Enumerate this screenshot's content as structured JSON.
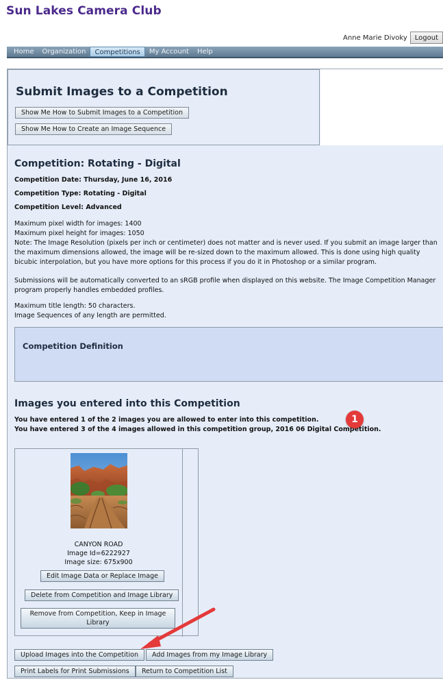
{
  "site": {
    "title": "Sun Lakes Camera Club"
  },
  "user": {
    "name": "Anne Marie Divoky",
    "logout_label": "Logout"
  },
  "nav": {
    "items": [
      "Home",
      "Organization",
      "Competitions",
      "My Account",
      "Help"
    ],
    "active": "Competitions"
  },
  "submit": {
    "title": "Submit Images to a Competition",
    "btn_how_submit": "Show Me How to Submit Images to a Competition",
    "btn_how_sequence": "Show Me How to Create an Image Sequence"
  },
  "competition": {
    "title": "Competition: Rotating - Digital",
    "date": "Competition Date: Thursday, June 16, 2016",
    "type": "Competition Type: Rotating - Digital",
    "level": "Competition Level: Advanced",
    "max_width": "Maximum pixel width for images: 1400",
    "max_height": "Maximum pixel height for images: 1050",
    "note": "Note: The Image Resolution (pixels per inch or centimeter) does not matter and is never used. If you submit an image larger than the maximum dimensions allowed, the image will be re-sized down to the maximum allowed. This is done using high quality bicubic interpolation, but you have more options for this process if you do it in Photoshop or a similar program.",
    "srgb": "Submissions will be automatically converted to an sRGB profile when displayed on this website. The Image Competition Manager program properly handles embedded profiles.",
    "max_title": "Maximum title length: 50 characters.",
    "sequences": "Image Sequences of any length are permitted.",
    "definition_title": "Competition Definition"
  },
  "entered": {
    "title": "Images you entered into this Competition",
    "line1": "You have entered 1 of the 2 images you are allowed to enter into this competition.",
    "line2": "You have entered 3 of the 4 images allowed in this competition group, 2016 06 Digital Competition.",
    "badge": "1"
  },
  "image": {
    "title": "CANYON ROAD",
    "id": "Image Id=6222927",
    "size": "Image size: 675x900",
    "btn_edit": "Edit Image Data or Replace Image",
    "btn_delete": "Delete from Competition and Image Library",
    "btn_remove_line1": "Remove from Competition, Keep in Image",
    "btn_remove_line2": "Library"
  },
  "actions": {
    "upload": "Upload Images into the Competition",
    "add_library": "Add Images from my Image Library",
    "print_labels": "Print Labels for Print Submissions",
    "return": "Return to Competition List"
  },
  "colors": {
    "brand": "#4b2a8c",
    "nav": "#6d879c",
    "panel": "#e6edf8",
    "definition": "#cfdcf4",
    "annotation": "#e43a3a"
  }
}
